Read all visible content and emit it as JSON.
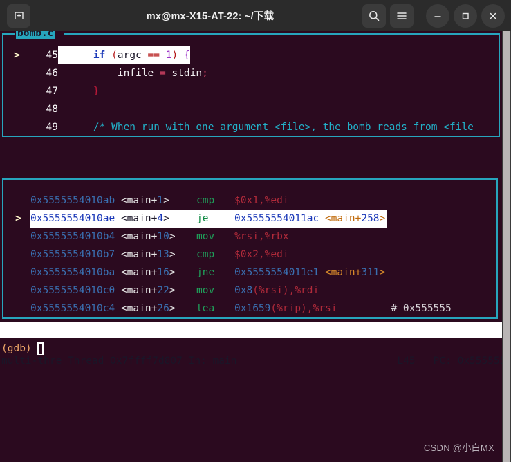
{
  "window": {
    "title": "mx@mx-X15-AT-22: ~/下载",
    "new_tab_label": "new-tab",
    "search_label": "Search",
    "menu_label": "Menu",
    "minimize_label": "Minimize",
    "maximize_label": "Maximize",
    "close_label": "Close"
  },
  "source_panel": {
    "title": "bomb.c",
    "lines": [
      {
        "marker": ">",
        "number": "45",
        "highlighted": true,
        "tokens": [
          {
            "text": "    ",
            "cls": "tok-id"
          },
          {
            "text": "if",
            "cls": "tok-kw"
          },
          {
            "text": " ",
            "cls": "tok-id"
          },
          {
            "text": "(",
            "cls": "tok-pun"
          },
          {
            "text": "argc",
            "cls": "tok-id"
          },
          {
            "text": " ",
            "cls": "tok-id"
          },
          {
            "text": "==",
            "cls": "tok-pun"
          },
          {
            "text": " ",
            "cls": "tok-id"
          },
          {
            "text": "1",
            "cls": "tok-num"
          },
          {
            "text": ")",
            "cls": "tok-pun"
          },
          {
            "text": " ",
            "cls": "tok-id"
          },
          {
            "text": "{",
            "cls": "tok-num"
          }
        ]
      },
      {
        "marker": "",
        "number": "46",
        "highlighted": false,
        "tokens": [
          {
            "text": "        infile",
            "cls": "tok-white"
          },
          {
            "text": " = ",
            "cls": "tok-op"
          },
          {
            "text": "stdin",
            "cls": "tok-white"
          },
          {
            "text": ";",
            "cls": "tok-op"
          }
        ]
      },
      {
        "marker": "",
        "number": "47",
        "highlighted": false,
        "tokens": [
          {
            "text": "    ",
            "cls": "tok-white"
          },
          {
            "text": "}",
            "cls": "tok-brace"
          }
        ]
      },
      {
        "marker": "",
        "number": "48",
        "highlighted": false,
        "tokens": [
          {
            "text": "",
            "cls": "tok-white"
          }
        ]
      },
      {
        "marker": "",
        "number": "49",
        "highlighted": false,
        "tokens": [
          {
            "text": "    /* When run with one argument <file>, the bomb reads from <file",
            "cls": "tok-cmt"
          }
        ]
      }
    ]
  },
  "asm_panel": {
    "lines": [
      {
        "marker": "",
        "current": false,
        "address": "0x5555554010ab",
        "symbol_open": "<main+",
        "symbol_off": "1",
        "symbol_close": ">",
        "mnemonic": "cmp",
        "operands": [
          {
            "text": "$0x1,%edi",
            "cls": "a-op"
          }
        ],
        "comment": ""
      },
      {
        "marker": ">",
        "current": true,
        "address": "0x5555554010ae",
        "symbol_open": "<main+",
        "symbol_off": "4",
        "symbol_close": ">",
        "mnemonic": "je",
        "operands": [
          {
            "text": "0x5555554011ac ",
            "cls": "a-num"
          },
          {
            "text": "<main+",
            "cls": "a-sym"
          },
          {
            "text": "258",
            "cls": "a-num"
          },
          {
            "text": ">",
            "cls": "a-sym"
          }
        ],
        "comment": ""
      },
      {
        "marker": "",
        "current": false,
        "address": "0x5555554010b4",
        "symbol_open": "<main+",
        "symbol_off": "10",
        "symbol_close": ">",
        "mnemonic": "mov",
        "operands": [
          {
            "text": "%rsi,%rbx",
            "cls": "a-op"
          }
        ],
        "comment": ""
      },
      {
        "marker": "",
        "current": false,
        "address": "0x5555554010b7",
        "symbol_open": "<main+",
        "symbol_off": "13",
        "symbol_close": ">",
        "mnemonic": "cmp",
        "operands": [
          {
            "text": "$0x2,%edi",
            "cls": "a-op"
          }
        ],
        "comment": ""
      },
      {
        "marker": "",
        "current": false,
        "address": "0x5555554010ba",
        "symbol_open": "<main+",
        "symbol_off": "16",
        "symbol_close": ">",
        "mnemonic": "jne",
        "operands": [
          {
            "text": "0x5555554011e1 ",
            "cls": "a-num"
          },
          {
            "text": "<main+",
            "cls": "a-sym"
          },
          {
            "text": "311",
            "cls": "a-num"
          },
          {
            "text": ">",
            "cls": "a-sym"
          }
        ],
        "comment": ""
      },
      {
        "marker": "",
        "current": false,
        "address": "0x5555554010c0",
        "symbol_open": "<main+",
        "symbol_off": "22",
        "symbol_close": ">",
        "mnemonic": "mov",
        "operands": [
          {
            "text": "0x8",
            "cls": "a-num"
          },
          {
            "text": "(",
            "cls": "a-op"
          },
          {
            "text": "%rsi",
            "cls": "a-reg"
          },
          {
            "text": "),",
            "cls": "a-op"
          },
          {
            "text": "%rdi",
            "cls": "a-reg"
          }
        ],
        "comment": ""
      },
      {
        "marker": "",
        "current": false,
        "address": "0x5555554010c4",
        "symbol_open": "<main+",
        "symbol_off": "26",
        "symbol_close": ">",
        "mnemonic": "lea",
        "operands": [
          {
            "text": "0x1659",
            "cls": "a-num"
          },
          {
            "text": "(",
            "cls": "a-op"
          },
          {
            "text": "%rip",
            "cls": "a-reg"
          },
          {
            "text": "),",
            "cls": "a-op"
          },
          {
            "text": "%rsi",
            "cls": "a-reg"
          }
        ],
        "comment": "# 0x555555"
      }
    ]
  },
  "status_bar": {
    "left": "multi-thre Thread 0x7ffff7d807 In: main",
    "line": "L45",
    "pc": "PC: 0x5555554010ae"
  },
  "prompt": {
    "text": "(gdb)"
  },
  "watermark": {
    "text": "CSDN @小白MX"
  },
  "colors": {
    "titlebar_bg": "#2b2b2b",
    "terminal_bg": "#2b0a1f",
    "tui_border": "#27a5bd",
    "highlight_bg": "#ffffff",
    "prompt_fg": "#f0a868",
    "scrollbar": "#b9b5b5"
  }
}
